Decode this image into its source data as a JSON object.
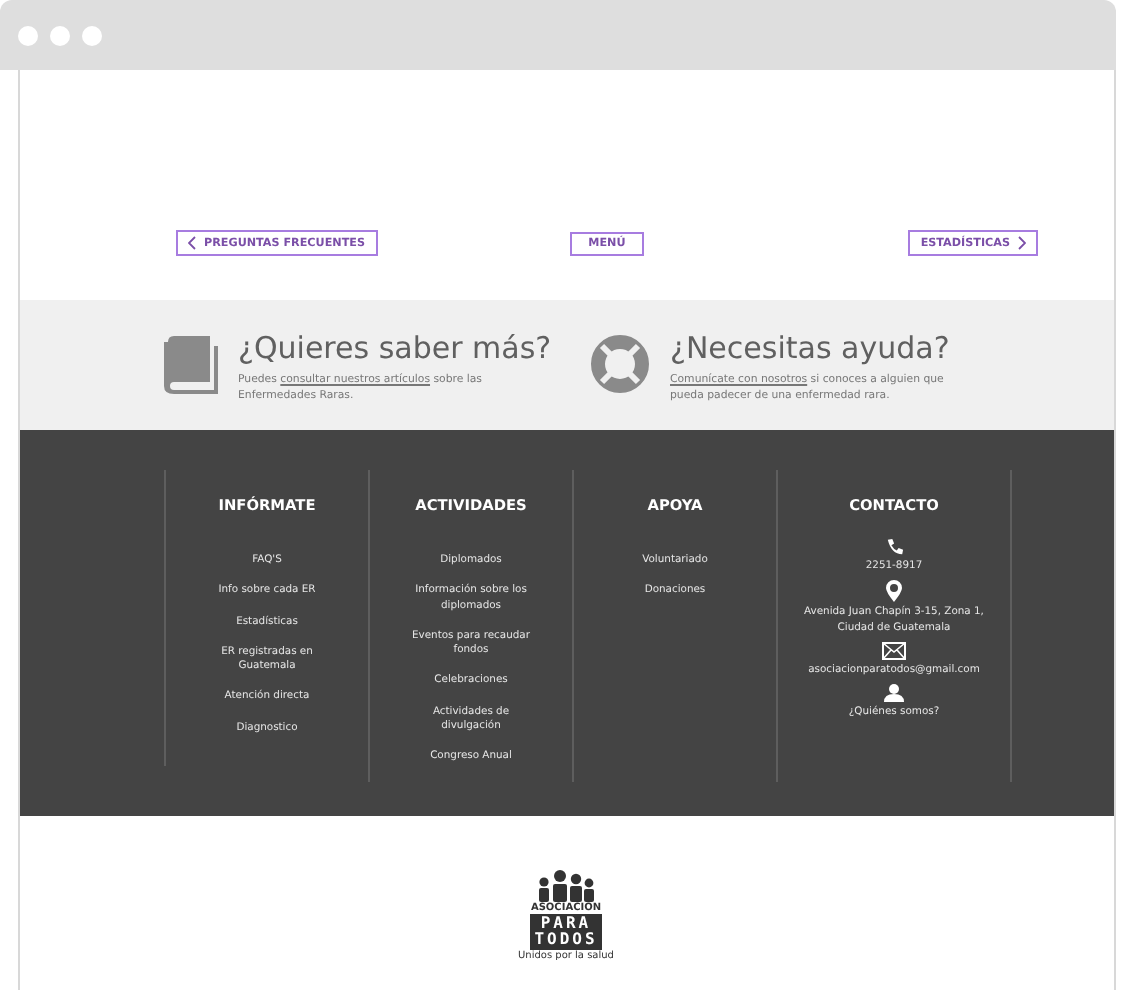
{
  "nav": [
    {
      "kind": "prev",
      "label": "PREGUNTAS FRECUENTES"
    },
    {
      "kind": "center",
      "label": "MENÚ"
    },
    {
      "kind": "next",
      "label": "ESTADÍSTICAS"
    }
  ],
  "help_band": [
    {
      "kind": "book",
      "title": "¿Quieres saber más?",
      "before": "Puedes",
      "link": "consultar nuestros artículos",
      "after": "sobre las Enfermedades Raras."
    },
    {
      "kind": "lifebuoy",
      "title": "¿Necesitas ayuda?",
      "link": "Comunícate con nosotros",
      "after": "si conoces a alguien que pueda padecer de una enfermedad rara."
    }
  ],
  "footer": {
    "columns": [
      {
        "heading": "INFÓRMATE",
        "items": [
          {
            "text": "FAQ'S"
          },
          {
            "text": "Info sobre cada ER"
          },
          {
            "text": "Estadísticas"
          },
          {
            "text": "ER registradas en Guatemala"
          },
          {
            "text": "Atención directa"
          },
          {
            "text": "Diagnostico"
          }
        ]
      },
      {
        "heading": "ACTIVIDADES",
        "items": [
          {
            "text": "Diplomados"
          },
          {
            "text": "Información sobre los diplomados"
          },
          {
            "text": "Eventos para recaudar fondos"
          },
          {
            "text": "Celebraciones"
          },
          {
            "text": "Actividades de divulgación"
          },
          {
            "text": "Congreso Anual"
          }
        ]
      },
      {
        "heading": "APOYA",
        "items": [
          {
            "text": "Voluntariado"
          },
          {
            "text": "Donaciones"
          }
        ]
      },
      {
        "heading": "CONTACTO",
        "items": [
          {
            "kind": "phone",
            "text": "2251-8917"
          },
          {
            "kind": "pin",
            "text": "Avenida Juan Chapín 3-15, Zona 1, Ciudad de Guatemala"
          },
          {
            "kind": "mail",
            "text": "asociacionparatodos@gmail.com"
          },
          {
            "kind": "person",
            "text": "¿Quiénes somos?"
          }
        ]
      }
    ]
  },
  "logo": {
    "top": "ASOCIACIÓN",
    "line1": "PARA",
    "line2": "TODOS",
    "tagline": "Unidos por la salud"
  }
}
